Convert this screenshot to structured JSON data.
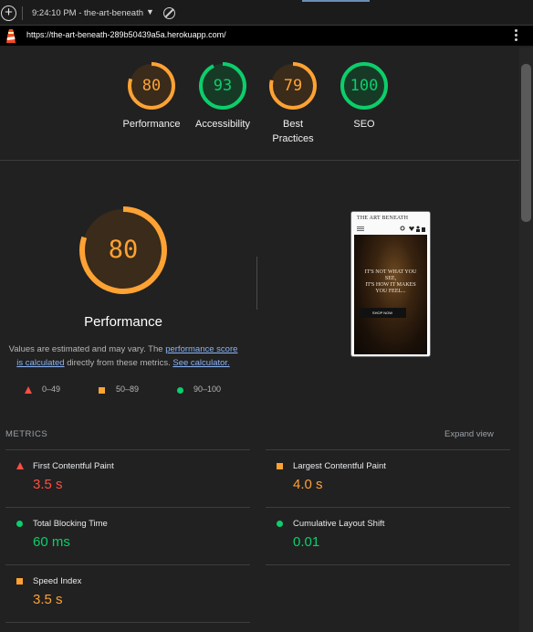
{
  "toolbar": {
    "plus": "+",
    "report_time": "9:24:10 PM - the-art-beneath",
    "dropdown": "▼"
  },
  "url": "https://the-art-beneath-289b50439a5a.herokuapp.com/",
  "gauges": [
    {
      "score": "80",
      "label": "Performance",
      "color": "#ffa234"
    },
    {
      "score": "93",
      "label": "Accessibility",
      "color": "#0cce6b"
    },
    {
      "score": "79",
      "label_lines": [
        "Best",
        "Practices"
      ],
      "color": "#ffa234"
    },
    {
      "score": "100",
      "label": "SEO",
      "color": "#0cce6b"
    }
  ],
  "performance": {
    "score": "80",
    "title": "Performance",
    "desc_1": "Values are estimated and may vary. The ",
    "desc_link_1a": "performance score",
    "desc_link_1b": "is calculated",
    "desc_2": " directly from these metrics. ",
    "desc_link_2": "See calculator."
  },
  "legend": {
    "fail": "0–49",
    "average": "50–89",
    "pass": "90–100"
  },
  "thumbnail": {
    "brand": "THE ART BENEATH",
    "line1": "IT'S NOT WHAT YOU",
    "line2": "SEE,",
    "line3": "IT'S HOW IT MAKES",
    "line4": "YOU FEEL...",
    "button": "SHOP NOW"
  },
  "metrics": {
    "heading": "METRICS",
    "expand": "Expand view",
    "items": [
      {
        "name": "First Contentful Paint",
        "value": "3.5 s",
        "rating": "fail"
      },
      {
        "name": "Largest Contentful Paint",
        "value": "4.0 s",
        "rating": "average"
      },
      {
        "name": "Total Blocking Time",
        "value": "60 ms",
        "rating": "pass"
      },
      {
        "name": "Cumulative Layout Shift",
        "value": "0.01",
        "rating": "pass"
      },
      {
        "name": "Speed Index",
        "value": "3.5 s",
        "rating": "average"
      }
    ]
  },
  "colors": {
    "fail": "#ff4e42",
    "average": "#ffa234",
    "pass": "#0cce6b"
  }
}
